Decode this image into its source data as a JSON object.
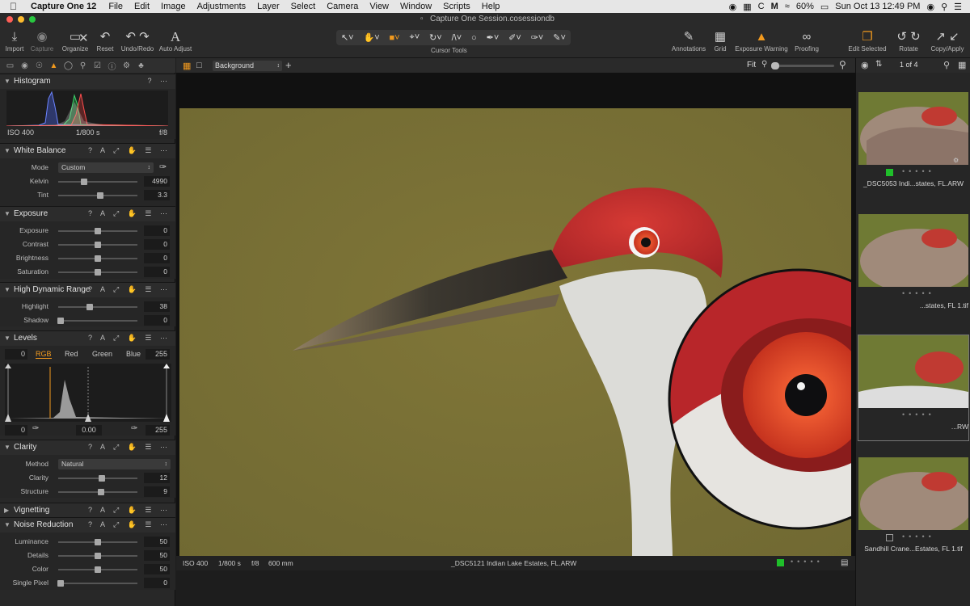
{
  "menubar": {
    "app": "Capture One 12",
    "items": [
      "File",
      "Edit",
      "Image",
      "Adjustments",
      "Layer",
      "Select",
      "Camera",
      "View",
      "Window",
      "Scripts",
      "Help"
    ],
    "battery": "60%",
    "datetime": "Sun Oct 13  12:49 PM"
  },
  "window": {
    "title": "Capture One Session.cosessiondb"
  },
  "toolbar": {
    "import": "Import",
    "capture": "Capture",
    "organize": "Organize",
    "reset": "Reset",
    "undo_redo": "Undo/Redo",
    "auto_adjust": "Auto Adjust",
    "cursor_tools": "Cursor Tools",
    "annotations": "Annotations",
    "grid": "Grid",
    "exposure_warning": "Exposure Warning",
    "proofing": "Proofing",
    "edit_selected": "Edit Selected",
    "rotate": "Rotate",
    "copy_apply": "Copy/Apply"
  },
  "histogram": {
    "title": "Histogram",
    "iso": "ISO 400",
    "shutter": "1/800 s",
    "aperture": "f/8"
  },
  "white_balance": {
    "title": "White Balance",
    "mode_label": "Mode",
    "mode_value": "Custom",
    "sliders": [
      {
        "label": "Kelvin",
        "value": "4990",
        "pos": 0.33
      },
      {
        "label": "Tint",
        "value": "3.3",
        "pos": 0.53
      }
    ]
  },
  "exposure": {
    "title": "Exposure",
    "sliders": [
      {
        "label": "Exposure",
        "value": "0",
        "pos": 0.5
      },
      {
        "label": "Contrast",
        "value": "0",
        "pos": 0.5
      },
      {
        "label": "Brightness",
        "value": "0",
        "pos": 0.5
      },
      {
        "label": "Saturation",
        "value": "0",
        "pos": 0.5
      }
    ]
  },
  "hdr": {
    "title": "High Dynamic Range",
    "sliders": [
      {
        "label": "Highlight",
        "value": "38",
        "pos": 0.4
      },
      {
        "label": "Shadow",
        "value": "0",
        "pos": 0.03
      }
    ]
  },
  "levels": {
    "title": "Levels",
    "left_val": "0",
    "right_val": "255",
    "channels": [
      "RGB",
      "Red",
      "Green",
      "Blue"
    ],
    "out_low": "0",
    "mid": "0.00",
    "out_high": "255"
  },
  "clarity": {
    "title": "Clarity",
    "method_label": "Method",
    "method_value": "Natural",
    "sliders": [
      {
        "label": "Clarity",
        "value": "12",
        "pos": 0.55
      },
      {
        "label": "Structure",
        "value": "9",
        "pos": 0.54
      }
    ]
  },
  "vignetting": {
    "title": "Vignetting"
  },
  "noise": {
    "title": "Noise Reduction",
    "sliders": [
      {
        "label": "Luminance",
        "value": "50",
        "pos": 0.5
      },
      {
        "label": "Details",
        "value": "50",
        "pos": 0.5
      },
      {
        "label": "Color",
        "value": "50",
        "pos": 0.5
      },
      {
        "label": "Single Pixel",
        "value": "0",
        "pos": 0.03
      }
    ]
  },
  "viewer": {
    "layer": "Background",
    "zoom": "Fit"
  },
  "status": {
    "iso": "ISO 400",
    "shutter": "1/800 s",
    "aperture": "f/8",
    "focal": "600 mm",
    "filename": "_DSC5121 Indian Lake Estates, FL.ARW"
  },
  "browser": {
    "count": "1 of 4",
    "thumbs": [
      {
        "name": "_DSC5053 Indi...states, FL.ARW"
      },
      {
        "name": "...states, FL 1.tif"
      },
      {
        "name": "...RW"
      },
      {
        "name": "Sandhill Crane...Estates, FL 1.tif"
      }
    ]
  },
  "colors": {
    "accent": "#f29a1e",
    "tag_green": "#1fbf2a",
    "background": "#7b7436"
  }
}
